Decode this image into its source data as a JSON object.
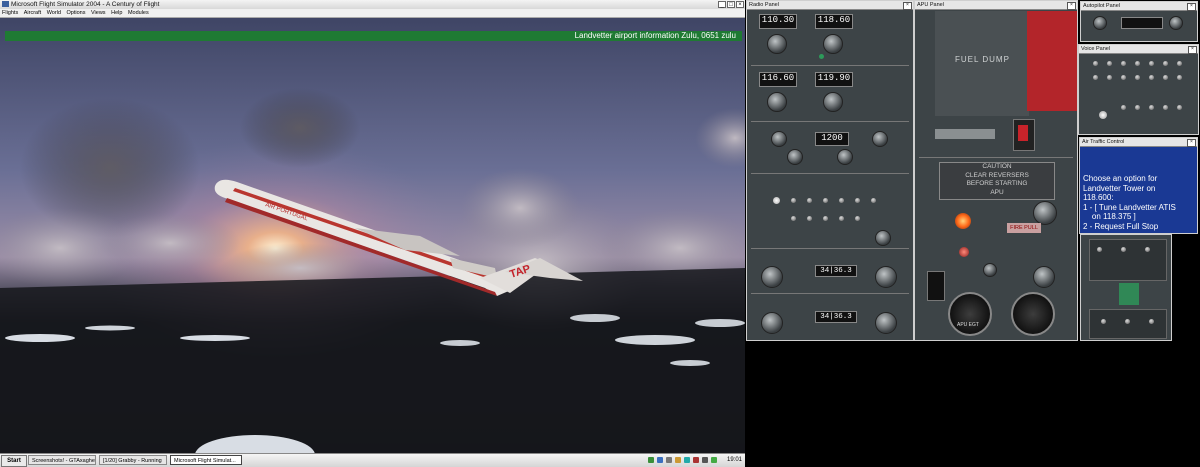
{
  "main_window": {
    "title": "Microsoft Flight Simulator 2004 - A Century of Flight",
    "menu": [
      "Flights",
      "Aircraft",
      "World",
      "Options",
      "Views",
      "Help",
      "Modules"
    ],
    "atis_text": "Landvetter airport information Zulu, 0651 zulu"
  },
  "aircraft": {
    "livery_text": "AIR PORTUGAL",
    "tail_text": "TAP"
  },
  "panels": {
    "radio": {
      "title": "Radio Panel",
      "com1": [
        "110.30",
        "118.60"
      ],
      "com2": [
        "116.60",
        "119.90"
      ],
      "transponder": "1200",
      "gauge_readout_1": "34|36.3",
      "gauge_readout_2": "34|36.3"
    },
    "apu": {
      "title": "APU Panel",
      "fuel_dump": "FUEL DUMP",
      "caution": [
        "CAUTION",
        "CLEAR REVERSERS",
        "BEFORE STARTING",
        "APU"
      ],
      "fire_pull": "FIRE PULL",
      "gauge_label": "APU EGT"
    },
    "autopilot": {
      "title": "Autopilot Panel"
    },
    "voice": {
      "title": "Voice Panel"
    },
    "atc": {
      "title": "Air Traffic Control",
      "lines": [
        "Choose an option for",
        "Landvetter Tower on",
        "118.600:",
        "1 - [ Tune Landvetter ATIS",
        "    on 118.375 ]",
        "2 - Request Full Stop"
      ]
    }
  },
  "taskbar": {
    "start": "Start",
    "tasks": [
      "Screenshots! - GTAxaghe...",
      "[1/20] Grabby - Running",
      "Microsoft Flight Simulat..."
    ],
    "clock": "19:01"
  },
  "colors": {
    "atis_bar": "#1f7a33",
    "atc_background": "#1a3994",
    "panel_metal": "#3d4447",
    "fuel_dump_red": "#b3252a"
  }
}
